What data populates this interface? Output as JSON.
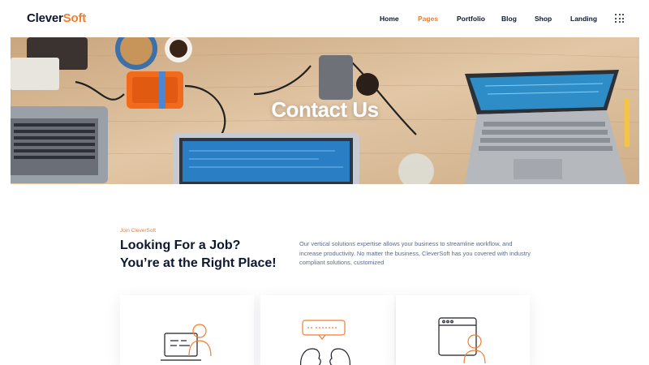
{
  "header": {
    "logo_part1": "Clever",
    "logo_part2": "Soft",
    "nav": [
      {
        "label": "Home",
        "active": false
      },
      {
        "label": "Pages",
        "active": true
      },
      {
        "label": "Portfolio",
        "active": false
      },
      {
        "label": "Blog",
        "active": false
      },
      {
        "label": "Shop",
        "active": false
      },
      {
        "label": "Landing",
        "active": false
      }
    ],
    "menu_icon": "grid-dots-icon"
  },
  "hero": {
    "title": "Contact Us"
  },
  "section": {
    "eyebrow": "Join CleverSoft",
    "heading_line1": "Looking For a Job?",
    "heading_line2": "You’re at the Right Place!",
    "description": "Our vertical solutions expertise allows your business to streamline workflow, and increase productivity. No matter the business, CleverSoft has you covered with industry compliant solutions, customized"
  },
  "cards": [
    {
      "icon": "remote-worker-icon"
    },
    {
      "icon": "conversation-icon"
    },
    {
      "icon": "browser-user-icon"
    }
  ],
  "colors": {
    "accent": "#f47c2c",
    "navy": "#0d1730",
    "body_text": "#5c6a8a"
  }
}
